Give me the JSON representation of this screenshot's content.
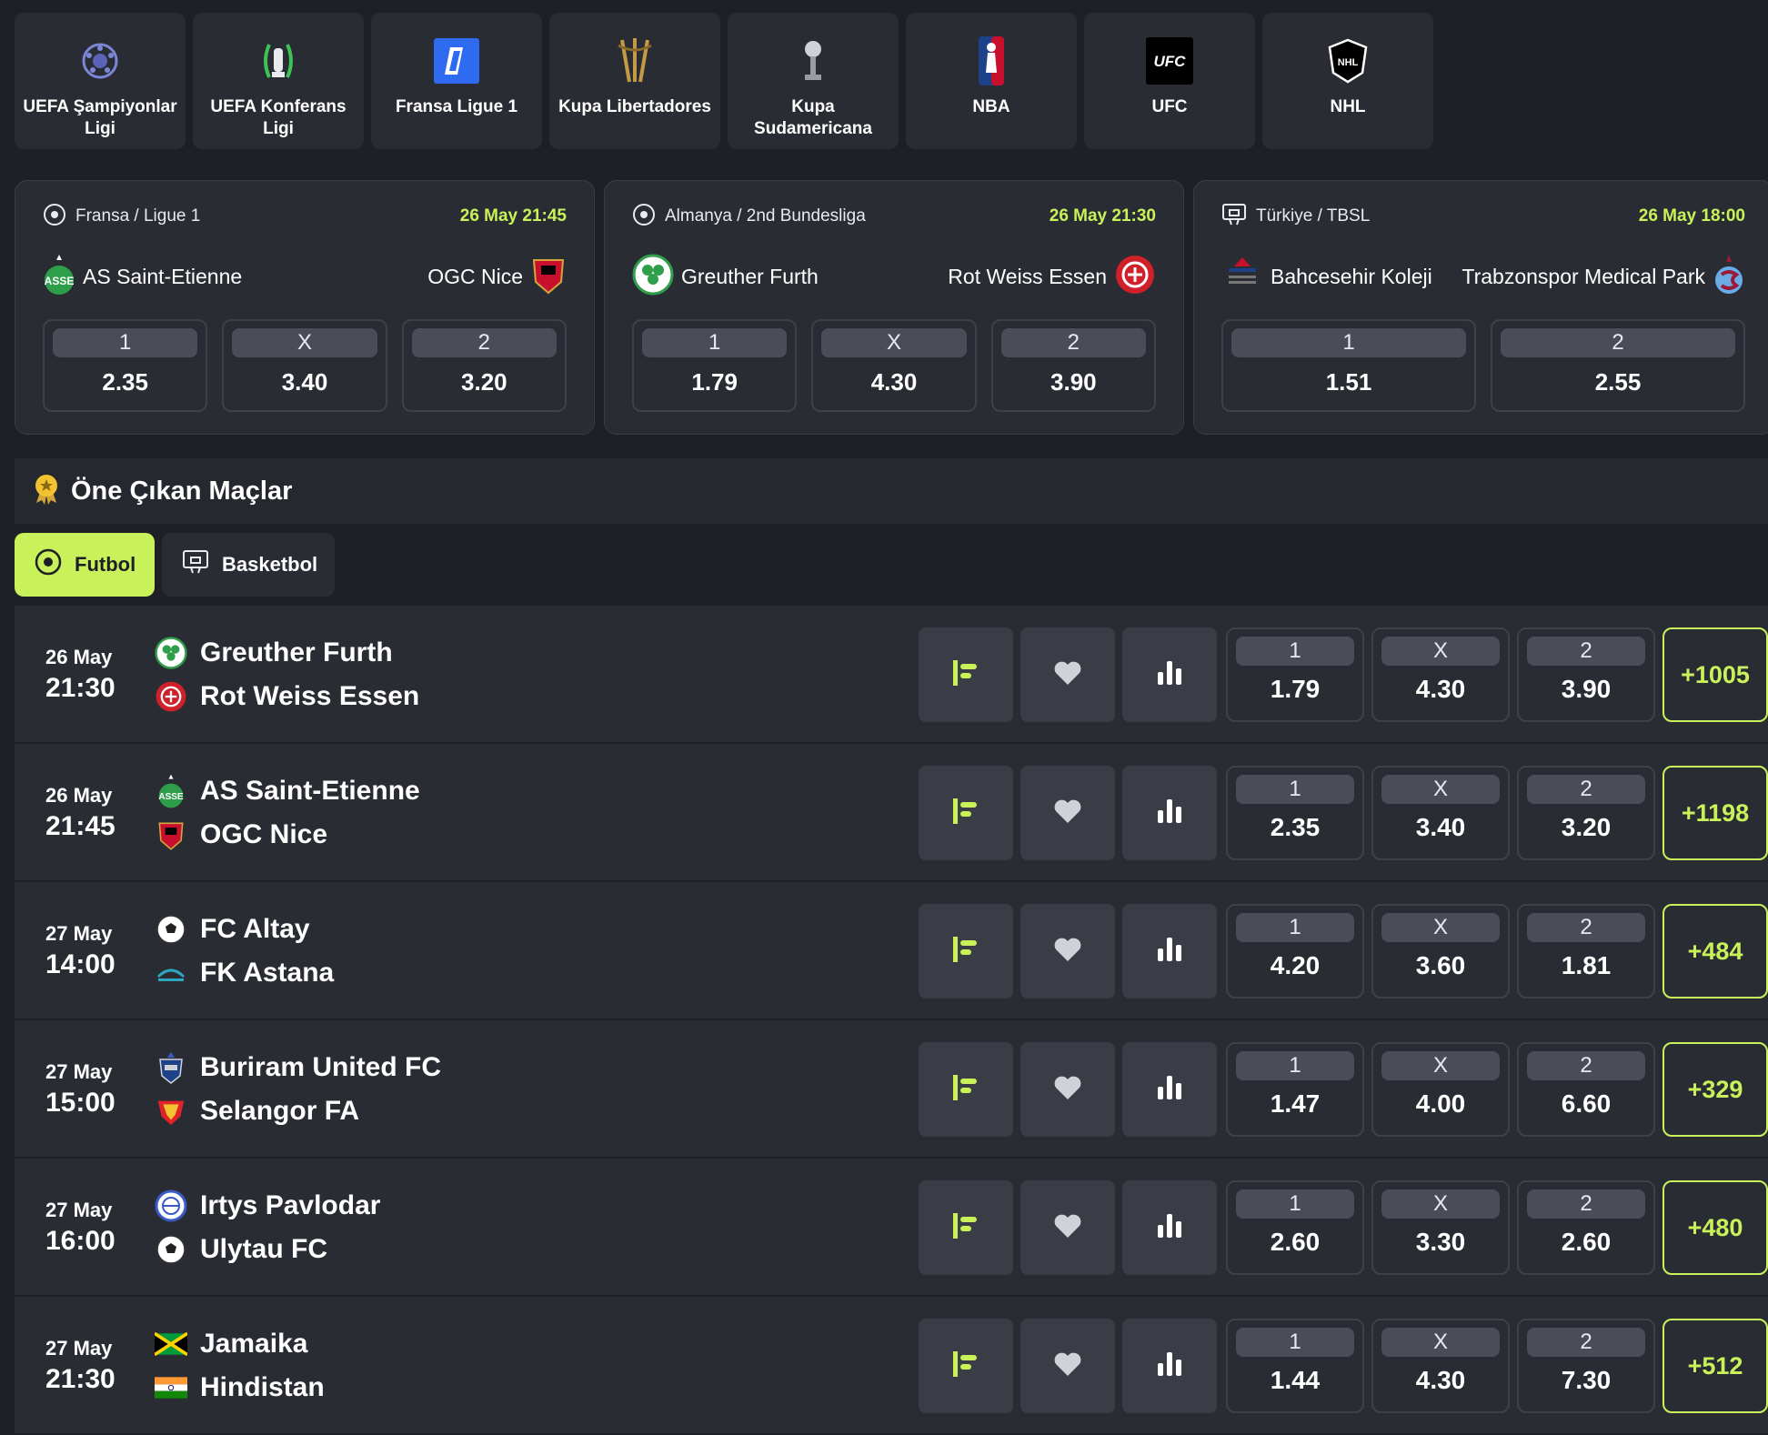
{
  "colors": {
    "accent": "#c8f15a",
    "background": "#1e2026",
    "panel": "#2a2c34"
  },
  "leagues": [
    {
      "label": "UEFA Şampiyonlar Ligi",
      "icon": "champions-league-icon"
    },
    {
      "label": "UEFA Konferans Ligi",
      "icon": "conference-league-icon"
    },
    {
      "label": "Fransa Ligue 1",
      "icon": "ligue1-icon"
    },
    {
      "label": "Kupa Libertadores",
      "icon": "libertadores-icon"
    },
    {
      "label": "Kupa Sudamericana",
      "icon": "sudamericana-icon"
    },
    {
      "label": "NBA",
      "icon": "nba-icon"
    },
    {
      "label": "UFC",
      "icon": "ufc-icon"
    },
    {
      "label": "NHL",
      "icon": "nhl-icon"
    }
  ],
  "cards": [
    {
      "league": "Fransa / Ligue 1",
      "date": "26 May 21:45",
      "home": "AS Saint-Etienne",
      "away": "OGC Nice",
      "odds": [
        {
          "label": "1",
          "value": "2.35"
        },
        {
          "label": "X",
          "value": "3.40"
        },
        {
          "label": "2",
          "value": "3.20"
        }
      ]
    },
    {
      "league": "Almanya / 2nd Bundesliga",
      "date": "26 May 21:30",
      "home": "Greuther Furth",
      "away": "Rot Weiss Essen",
      "odds": [
        {
          "label": "1",
          "value": "1.79"
        },
        {
          "label": "X",
          "value": "4.30"
        },
        {
          "label": "2",
          "value": "3.90"
        }
      ]
    },
    {
      "league": "Türkiye / TBSL",
      "date": "26 May 18:00",
      "home": "Bahcesehir Koleji",
      "away": "Trabzonspor Medical Park",
      "odds": [
        {
          "label": "1",
          "value": "1.51"
        },
        {
          "label": "2",
          "value": "2.55"
        }
      ]
    }
  ],
  "featured": {
    "title": "Öne Çıkan Maçlar",
    "tabs": [
      {
        "label": "Futbol"
      },
      {
        "label": "Basketbol"
      }
    ]
  },
  "matches": [
    {
      "day": "26 May",
      "time": "21:30",
      "home": "Greuther Furth",
      "away": "Rot Weiss Essen",
      "odds": [
        {
          "label": "1",
          "value": "1.79"
        },
        {
          "label": "X",
          "value": "4.30"
        },
        {
          "label": "2",
          "value": "3.90"
        }
      ],
      "more": "+1005"
    },
    {
      "day": "26 May",
      "time": "21:45",
      "home": "AS Saint-Etienne",
      "away": "OGC Nice",
      "odds": [
        {
          "label": "1",
          "value": "2.35"
        },
        {
          "label": "X",
          "value": "3.40"
        },
        {
          "label": "2",
          "value": "3.20"
        }
      ],
      "more": "+1198"
    },
    {
      "day": "27 May",
      "time": "14:00",
      "home": "FC Altay",
      "away": "FK Astana",
      "odds": [
        {
          "label": "1",
          "value": "4.20"
        },
        {
          "label": "X",
          "value": "3.60"
        },
        {
          "label": "2",
          "value": "1.81"
        }
      ],
      "more": "+484"
    },
    {
      "day": "27 May",
      "time": "15:00",
      "home": "Buriram United FC",
      "away": "Selangor FA",
      "odds": [
        {
          "label": "1",
          "value": "1.47"
        },
        {
          "label": "X",
          "value": "4.00"
        },
        {
          "label": "2",
          "value": "6.60"
        }
      ],
      "more": "+329"
    },
    {
      "day": "27 May",
      "time": "16:00",
      "home": "Irtys Pavlodar",
      "away": "Ulytau FC",
      "odds": [
        {
          "label": "1",
          "value": "2.60"
        },
        {
          "label": "X",
          "value": "3.30"
        },
        {
          "label": "2",
          "value": "2.60"
        }
      ],
      "more": "+480"
    },
    {
      "day": "27 May",
      "time": "21:30",
      "home": "Jamaika",
      "away": "Hindistan",
      "odds": [
        {
          "label": "1",
          "value": "1.44"
        },
        {
          "label": "X",
          "value": "4.30"
        },
        {
          "label": "2",
          "value": "7.30"
        }
      ],
      "more": "+512"
    }
  ]
}
